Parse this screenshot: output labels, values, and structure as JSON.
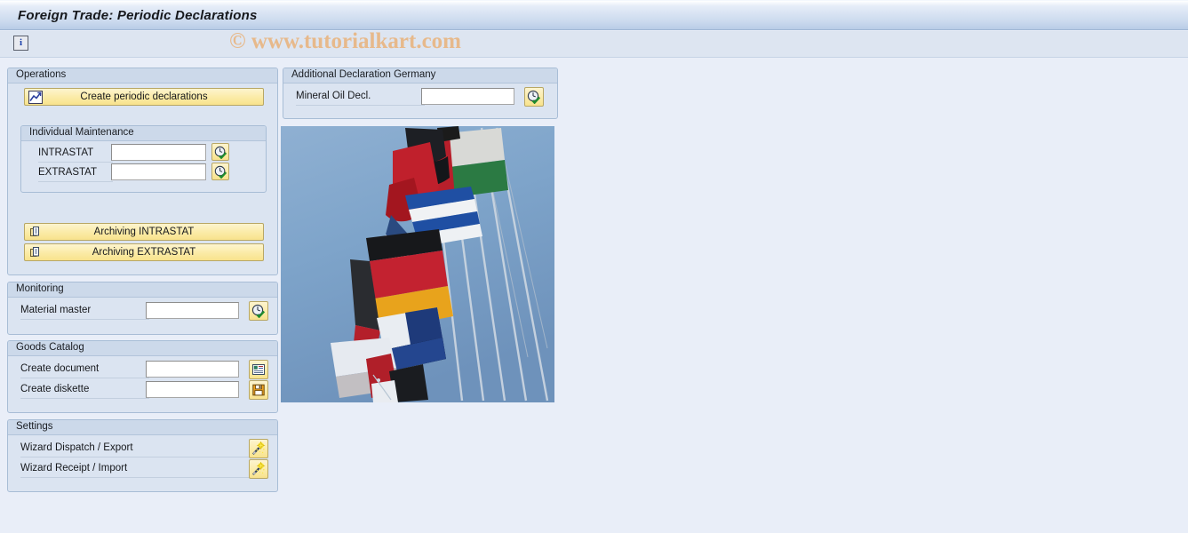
{
  "window": {
    "title": "Foreign Trade: Periodic Declarations"
  },
  "toolbar": {
    "info_icon": "info-icon",
    "info_label": "i"
  },
  "watermark": "© www.tutorialkart.com",
  "operations": {
    "title": "Operations",
    "create_button": {
      "label": "Create periodic declarations",
      "icon": "chart-line-icon"
    },
    "individual_maintenance": {
      "title": "Individual Maintenance",
      "rows": [
        {
          "label": "INTRASTAT",
          "value": "",
          "icon": "clock-check-icon"
        },
        {
          "label": "EXTRASTAT",
          "value": "",
          "icon": "clock-check-icon"
        }
      ]
    },
    "archiving_buttons": [
      {
        "label": "Archiving INTRASTAT",
        "icon": "copy-document-icon"
      },
      {
        "label": "Archiving EXTRASTAT",
        "icon": "copy-document-icon"
      }
    ]
  },
  "monitoring": {
    "title": "Monitoring",
    "rows": [
      {
        "label": "Material master",
        "value": "",
        "icon": "clock-check-icon"
      }
    ]
  },
  "goods_catalog": {
    "title": "Goods Catalog",
    "rows": [
      {
        "label": "Create document",
        "value": "",
        "icon": "document-icon"
      },
      {
        "label": "Create diskette",
        "value": "",
        "icon": "floppy-disk-icon"
      }
    ]
  },
  "settings": {
    "title": "Settings",
    "rows": [
      {
        "label": "Wizard Dispatch / Export",
        "icon": "magic-wand-icon"
      },
      {
        "label": "Wizard Receipt / Import",
        "icon": "magic-wand-icon"
      }
    ]
  },
  "additional_declaration": {
    "title": "Additional Declaration Germany",
    "rows": [
      {
        "label": "Mineral Oil Decl.",
        "value": "",
        "icon": "clock-check-icon"
      }
    ]
  },
  "image": {
    "name": "european-flags-photo",
    "alt": "Row of European national flags on flagpoles against a blue sky"
  },
  "colors": {
    "background": "#e9eef8",
    "panel": "#dbe4f1",
    "panel_header": "#ccd9ea",
    "button": "#fbeca9",
    "border": "#a8bdd6",
    "sky": "#7ba0c8"
  }
}
